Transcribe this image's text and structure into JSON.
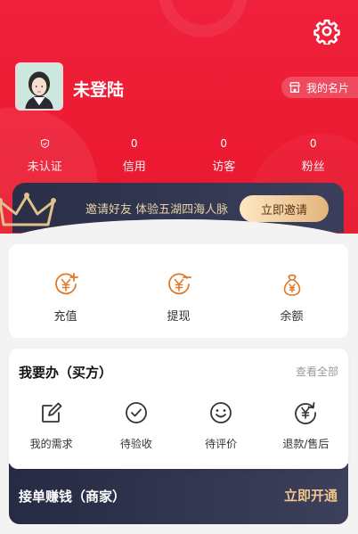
{
  "header": {
    "username": "未登陆",
    "card_label": "我的名片",
    "settings_icon": "gear-icon"
  },
  "stats": [
    {
      "value": "",
      "label": "未认证",
      "icon": "shield-icon"
    },
    {
      "value": "0",
      "label": "信用"
    },
    {
      "value": "0",
      "label": "访客"
    },
    {
      "value": "0",
      "label": "粉丝"
    }
  ],
  "invite": {
    "text": "邀请好友 体验五湖四海人脉",
    "button": "立即邀请"
  },
  "wallet": [
    {
      "label": "充值",
      "icon": "yuan-plus-icon"
    },
    {
      "label": "提现",
      "icon": "yuan-minus-icon"
    },
    {
      "label": "余额",
      "icon": "money-bag-icon"
    }
  ],
  "buyer": {
    "title": "我要办（买方）",
    "view_all": "查看全部",
    "orders": [
      {
        "label": "我的需求",
        "icon": "edit-icon"
      },
      {
        "label": "待验收",
        "icon": "check-circle-icon"
      },
      {
        "label": "待评价",
        "icon": "smile-icon"
      },
      {
        "label": "退款/售后",
        "icon": "refund-icon"
      }
    ]
  },
  "merchant": {
    "title": "接单赚钱（商家）",
    "button": "立即开通"
  },
  "colors": {
    "brand_red": "#ec1b32",
    "gold": "#f0c68a",
    "icon_orange": "#e07a2a",
    "dark_banner": "#2a2f47"
  }
}
